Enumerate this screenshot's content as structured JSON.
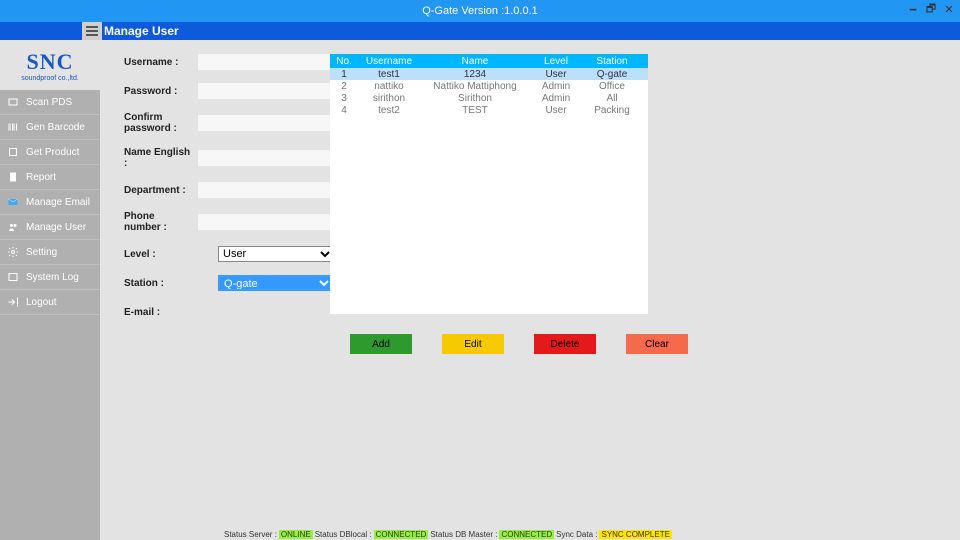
{
  "titlebar": {
    "title": "Q-Gate Version :1.0.0.1"
  },
  "subheader": {
    "title": "Manage User"
  },
  "logo": {
    "main": "SNC",
    "sub": "soundproof co.,ltd."
  },
  "nav": [
    {
      "label": "Scan PDS",
      "icon": "scan-icon"
    },
    {
      "label": "Gen Barcode",
      "icon": "barcode-icon"
    },
    {
      "label": "Get Product",
      "icon": "product-icon"
    },
    {
      "label": "Report",
      "icon": "report-icon"
    },
    {
      "label": "Manage Email",
      "icon": "mail-icon"
    },
    {
      "label": "Manage User",
      "icon": "users-icon"
    },
    {
      "label": "Setting",
      "icon": "gear-icon"
    },
    {
      "label": "System Log",
      "icon": "log-icon"
    },
    {
      "label": "Logout",
      "icon": "logout-icon"
    }
  ],
  "form": {
    "username_label": "Username :",
    "password_label": "Password :",
    "confirm_label": "Confirm password :",
    "name_en_label": "Name English :",
    "department_label": "Department :",
    "phone_label": "Phone number :",
    "level_label": "Level :",
    "station_label": "Station :",
    "email_label": "E-mail :",
    "level_value": "User",
    "station_value": "Q-gate"
  },
  "table": {
    "headers": {
      "no": "No.",
      "username": "Username",
      "name": "Name",
      "level": "Level",
      "station": "Station"
    },
    "rows": [
      {
        "no": "1",
        "username": "test1",
        "name": "1234",
        "level": "User",
        "station": "Q-gate",
        "selected": true
      },
      {
        "no": "2",
        "username": "nattiko",
        "name": "Nattiko Mattiphong",
        "level": "Admin",
        "station": "Office"
      },
      {
        "no": "3",
        "username": "sirithon",
        "name": "Sirithon",
        "level": "Admin",
        "station": "All"
      },
      {
        "no": "4",
        "username": "test2",
        "name": "TEST",
        "level": "User",
        "station": "Packing"
      }
    ]
  },
  "buttons": {
    "add": "Add",
    "edit": "Edit",
    "delete": "Delete",
    "clear": "Clear"
  },
  "status": {
    "l1": "Status Server :",
    "v1": "ONLINE",
    "l2": "Status DBlocal :",
    "v2": "CONNECTED",
    "l3": "Status DB Master :",
    "v3": "CONNECTED",
    "l4": "Sync Data :",
    "v4": "SYNC COMPLETE"
  }
}
